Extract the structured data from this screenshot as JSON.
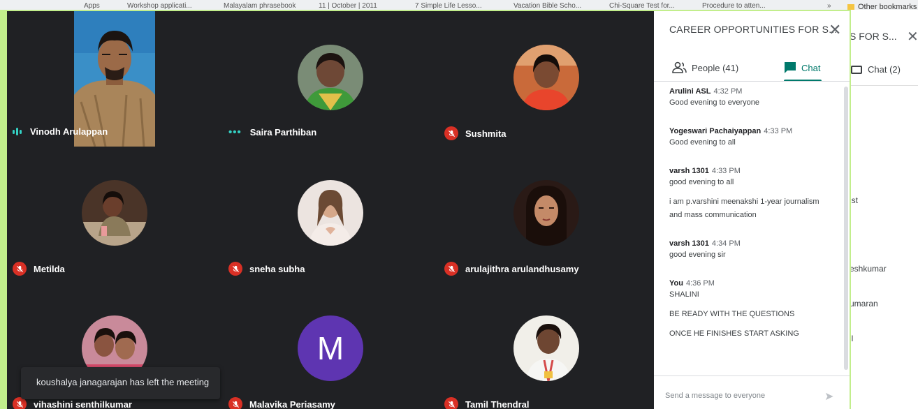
{
  "bookmarks": [
    "Apps",
    "Workshop applicati...",
    "Malayalam phrasebook",
    "11 | October | 2011",
    "7 Simple Life Lesso...",
    "Vacation Bible Scho...",
    "Chi-Square Test for...",
    "Procedure to atten...",
    "»"
  ],
  "other_bookmarks": "Other bookmarks",
  "background_window": {
    "title": "S FOR S...",
    "chat_tab": "Chat (2)",
    "fragments": [
      "ist",
      "eshkumar",
      "umaran",
      "il"
    ]
  },
  "participants": [
    {
      "name": "Vinodh Arulappan",
      "status": "speaking"
    },
    {
      "name": "Saira Parthiban",
      "status": "dots"
    },
    {
      "name": "Sushmita",
      "status": "muted"
    },
    {
      "name": "Metilda",
      "status": "muted"
    },
    {
      "name": "sneha subha",
      "status": "muted"
    },
    {
      "name": "arulajithra arulandhusamy",
      "status": "muted"
    },
    {
      "name": "vihashini senthilkumar",
      "status": "muted"
    },
    {
      "name": "Malavika Periasamy",
      "status": "muted",
      "initial": "M"
    },
    {
      "name": "Tamil Thendral",
      "status": "muted"
    }
  ],
  "toast": "koushalya janagarajan has left the meeting",
  "panel": {
    "title": "CAREER OPPORTUNITIES FOR S...",
    "people_tab": "People (41)",
    "chat_tab": "Chat",
    "input_placeholder": "Send a message to everyone",
    "messages": [
      {
        "sender": "Arulini ASL",
        "time": "4:32 PM",
        "lines": [
          "Good evening to everyone"
        ]
      },
      {
        "sender": "Yogeswari Pachaiyappan",
        "time": "4:33 PM",
        "lines": [
          "Good evening to all"
        ]
      },
      {
        "sender": "varsh 1301",
        "time": "4:33 PM",
        "lines": [
          "good evening to all"
        ]
      },
      {
        "sender": "",
        "time": "",
        "lines": [
          "i am p.varshini meenakshi 1-year journalism",
          "and mass communication"
        ]
      },
      {
        "sender": "varsh 1301",
        "time": "4:34 PM",
        "lines": [
          "good evening sir"
        ]
      },
      {
        "sender": "You",
        "time": "4:36 PM",
        "lines": [
          "SHALINI"
        ]
      },
      {
        "sender": "",
        "time": "",
        "lines": [
          "BE READY WITH THE QUESTIONS"
        ]
      },
      {
        "sender": "",
        "time": "",
        "lines": [
          "ONCE HE FINISHES START ASKING"
        ]
      }
    ]
  },
  "colors": {
    "meet_bg": "#202124",
    "accent": "#00796b",
    "muted_red": "#d93025",
    "glow": "#c2ee8c"
  }
}
